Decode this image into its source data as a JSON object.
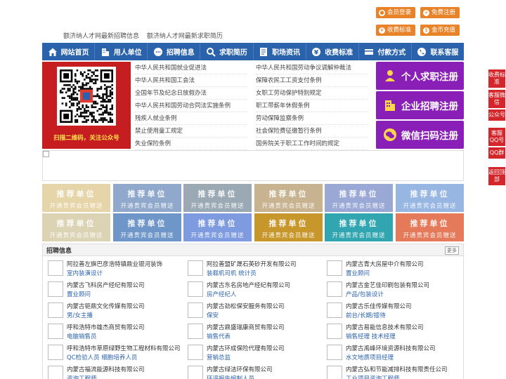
{
  "top_links": [
    "额济纳人才网最新招聘信息",
    "额济纳人才网最新求职简历"
  ],
  "top_buttons": [
    {
      "label": "会员登录",
      "icon": "user-icon"
    },
    {
      "label": "免费注册",
      "icon": "user-add-icon"
    },
    {
      "label": "收费标准",
      "icon": "yen-icon"
    },
    {
      "label": "金币充值",
      "icon": "coin-icon"
    }
  ],
  "nav": [
    {
      "label": "网站首页",
      "icon": "home-icon"
    },
    {
      "label": "用人单位",
      "icon": "building-icon"
    },
    {
      "label": "招聘信息",
      "icon": "chat-icon"
    },
    {
      "label": "求职简历",
      "icon": "search-icon"
    },
    {
      "label": "职场资讯",
      "icon": "document-icon"
    },
    {
      "label": "收费标准",
      "icon": "yen-icon"
    },
    {
      "label": "付款方式",
      "icon": "card-icon"
    },
    {
      "label": "联系客服",
      "icon": "phone-icon"
    }
  ],
  "promo": {
    "caption": "扫描二维码，关注公众号"
  },
  "laws_left": [
    "中华人民共和国就业促进法",
    "中华人民共和国工会法",
    "全国年节及纪念日放假办法",
    "中华人民共和国劳动合同法实施条例",
    "残疾人就业条例",
    "禁止使用童工规定",
    "失业保险条例"
  ],
  "laws_right": [
    "中华人民共和国劳动争议调解仲裁法",
    "保障农民工工资支付条例",
    "女职工劳动保护特别规定",
    "职工带薪年休假条例",
    "劳动保障监察条例",
    "社会保险费征缴暂行条例",
    "国务院关于职工工作时间的规定"
  ],
  "register": [
    {
      "label": "个人求职注册",
      "icon": "person-icon"
    },
    {
      "label": "企业招聘注册",
      "icon": "company-icon"
    },
    {
      "label": "微信扫码注册",
      "icon": "wechat-icon"
    }
  ],
  "float_bar": [
    {
      "label": "收费标准"
    },
    {
      "label": "客服微信"
    },
    {
      "label": "公众号"
    },
    {
      "label": "客服QQ号"
    },
    {
      "label": "QQ群"
    },
    {
      "label": "返回顶部"
    }
  ],
  "recommend": {
    "title": "推荐单位",
    "subtitle": "开通贵宾会员赠送",
    "colors": [
      "#e6d5a8",
      "#8fa8cc",
      "#9aa9b4",
      "#c7b38f",
      "#9aa8d6",
      "#98b6e2",
      "#dcd2b4",
      "#6f96c8",
      "#7e9be0",
      "#c8972c",
      "#31a6b0",
      "#e47a5a"
    ]
  },
  "jobs": {
    "title": "招聘信息",
    "more": "更多",
    "items": [
      {
        "company": "阿拉善左旗巴彦浩特镇鼎业银河装饰",
        "position": "室内装潢设计"
      },
      {
        "company": "阿拉善盟矿晟石英砂开发有限公司",
        "position": "装载机司机 统计员"
      },
      {
        "company": "内蒙古青大房屋中介有限公司",
        "position": "置业顾问"
      },
      {
        "company": "内蒙古飞科房产经纪有限公司",
        "position": "置业顾问"
      },
      {
        "company": "内蒙古东名房地产经纪有限公司",
        "position": "房产经纪人"
      },
      {
        "company": "内蒙古金艺佳印刷包装有限公司",
        "position": "产品/包装设计"
      },
      {
        "company": "内蒙古钜鼎文化传媒有限公司",
        "position": "男/女主播"
      },
      {
        "company": "内蒙古劲松保安服务有限公司",
        "position": "保安"
      },
      {
        "company": "内蒙古乐佳传媒有限公司",
        "position": "前台/长期/接待"
      },
      {
        "company": "呼和浩特市雄杰商贸有限公司",
        "position": "电脑销售员"
      },
      {
        "company": "内蒙古鼎盛瑞康商贸有限公司",
        "position": "销售代表"
      },
      {
        "company": "内蒙古易能信息技术有限公司",
        "position": "销售经理 技术经理"
      },
      {
        "company": "呼和浩特市草原绿野生物工程材料有限公司",
        "position": "QC检验人员 细胞培养人员"
      },
      {
        "company": "内蒙古环成保险代理有限公司",
        "position": "营销总监"
      },
      {
        "company": "内蒙古禹峰环境资源科技有限公司",
        "position": "水文地质项目经理"
      },
      {
        "company": "内蒙古福流能源科技有限公司",
        "position": "咨询工程师"
      },
      {
        "company": "内蒙古绿洁环保有限公司",
        "position": "环评报告编制人员"
      },
      {
        "company": "内蒙古弘和节能减排科技有限责任公司",
        "position": "工业项目咨询工程师"
      }
    ]
  }
}
